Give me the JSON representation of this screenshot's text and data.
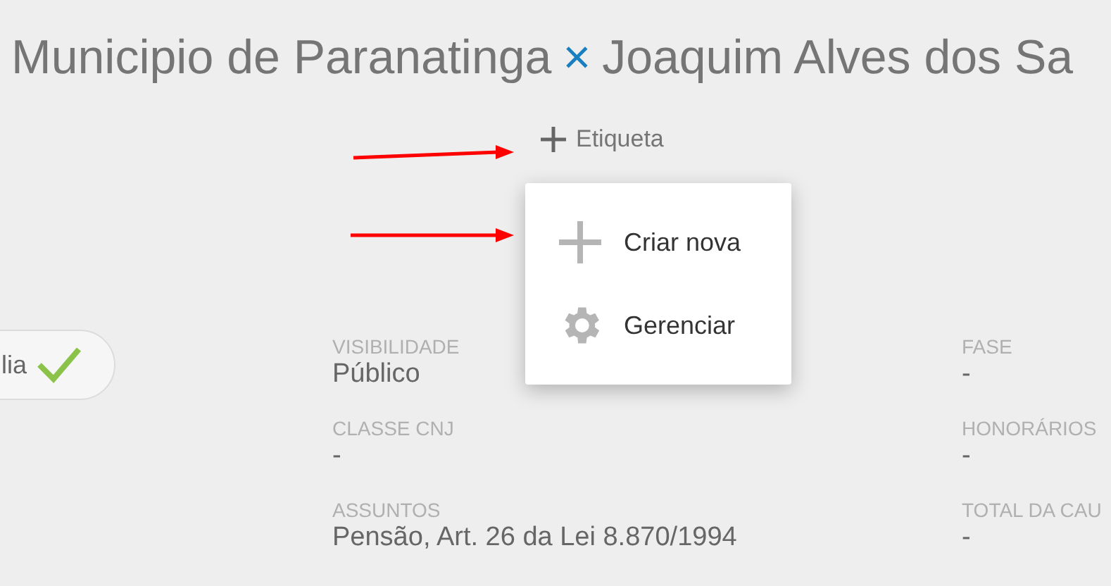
{
  "title": {
    "left": "Municipio de Paranatinga",
    "separator": "×",
    "right": "Joaquim Alves dos Sa"
  },
  "tag_button": {
    "label": "Etiqueta"
  },
  "menu": {
    "items": [
      {
        "kind": "add",
        "label": "Criar nova"
      },
      {
        "kind": "settings",
        "label": "Gerenciar"
      }
    ]
  },
  "status_chip": {
    "label": "lia",
    "checked": true
  },
  "fields_left": [
    {
      "label": "VISIBILIDADE",
      "value": "Público"
    },
    {
      "label": "CLASSE CNJ",
      "value": "-"
    },
    {
      "label": "ASSUNTOS",
      "value": "Pensão, Art. 26 da Lei 8.870/1994"
    }
  ],
  "fields_right": [
    {
      "label": "FASE",
      "value": "-"
    },
    {
      "label": "HONORÁRIOS",
      "value": "-"
    },
    {
      "label": "TOTAL DA CAU",
      "value": "-"
    }
  ]
}
